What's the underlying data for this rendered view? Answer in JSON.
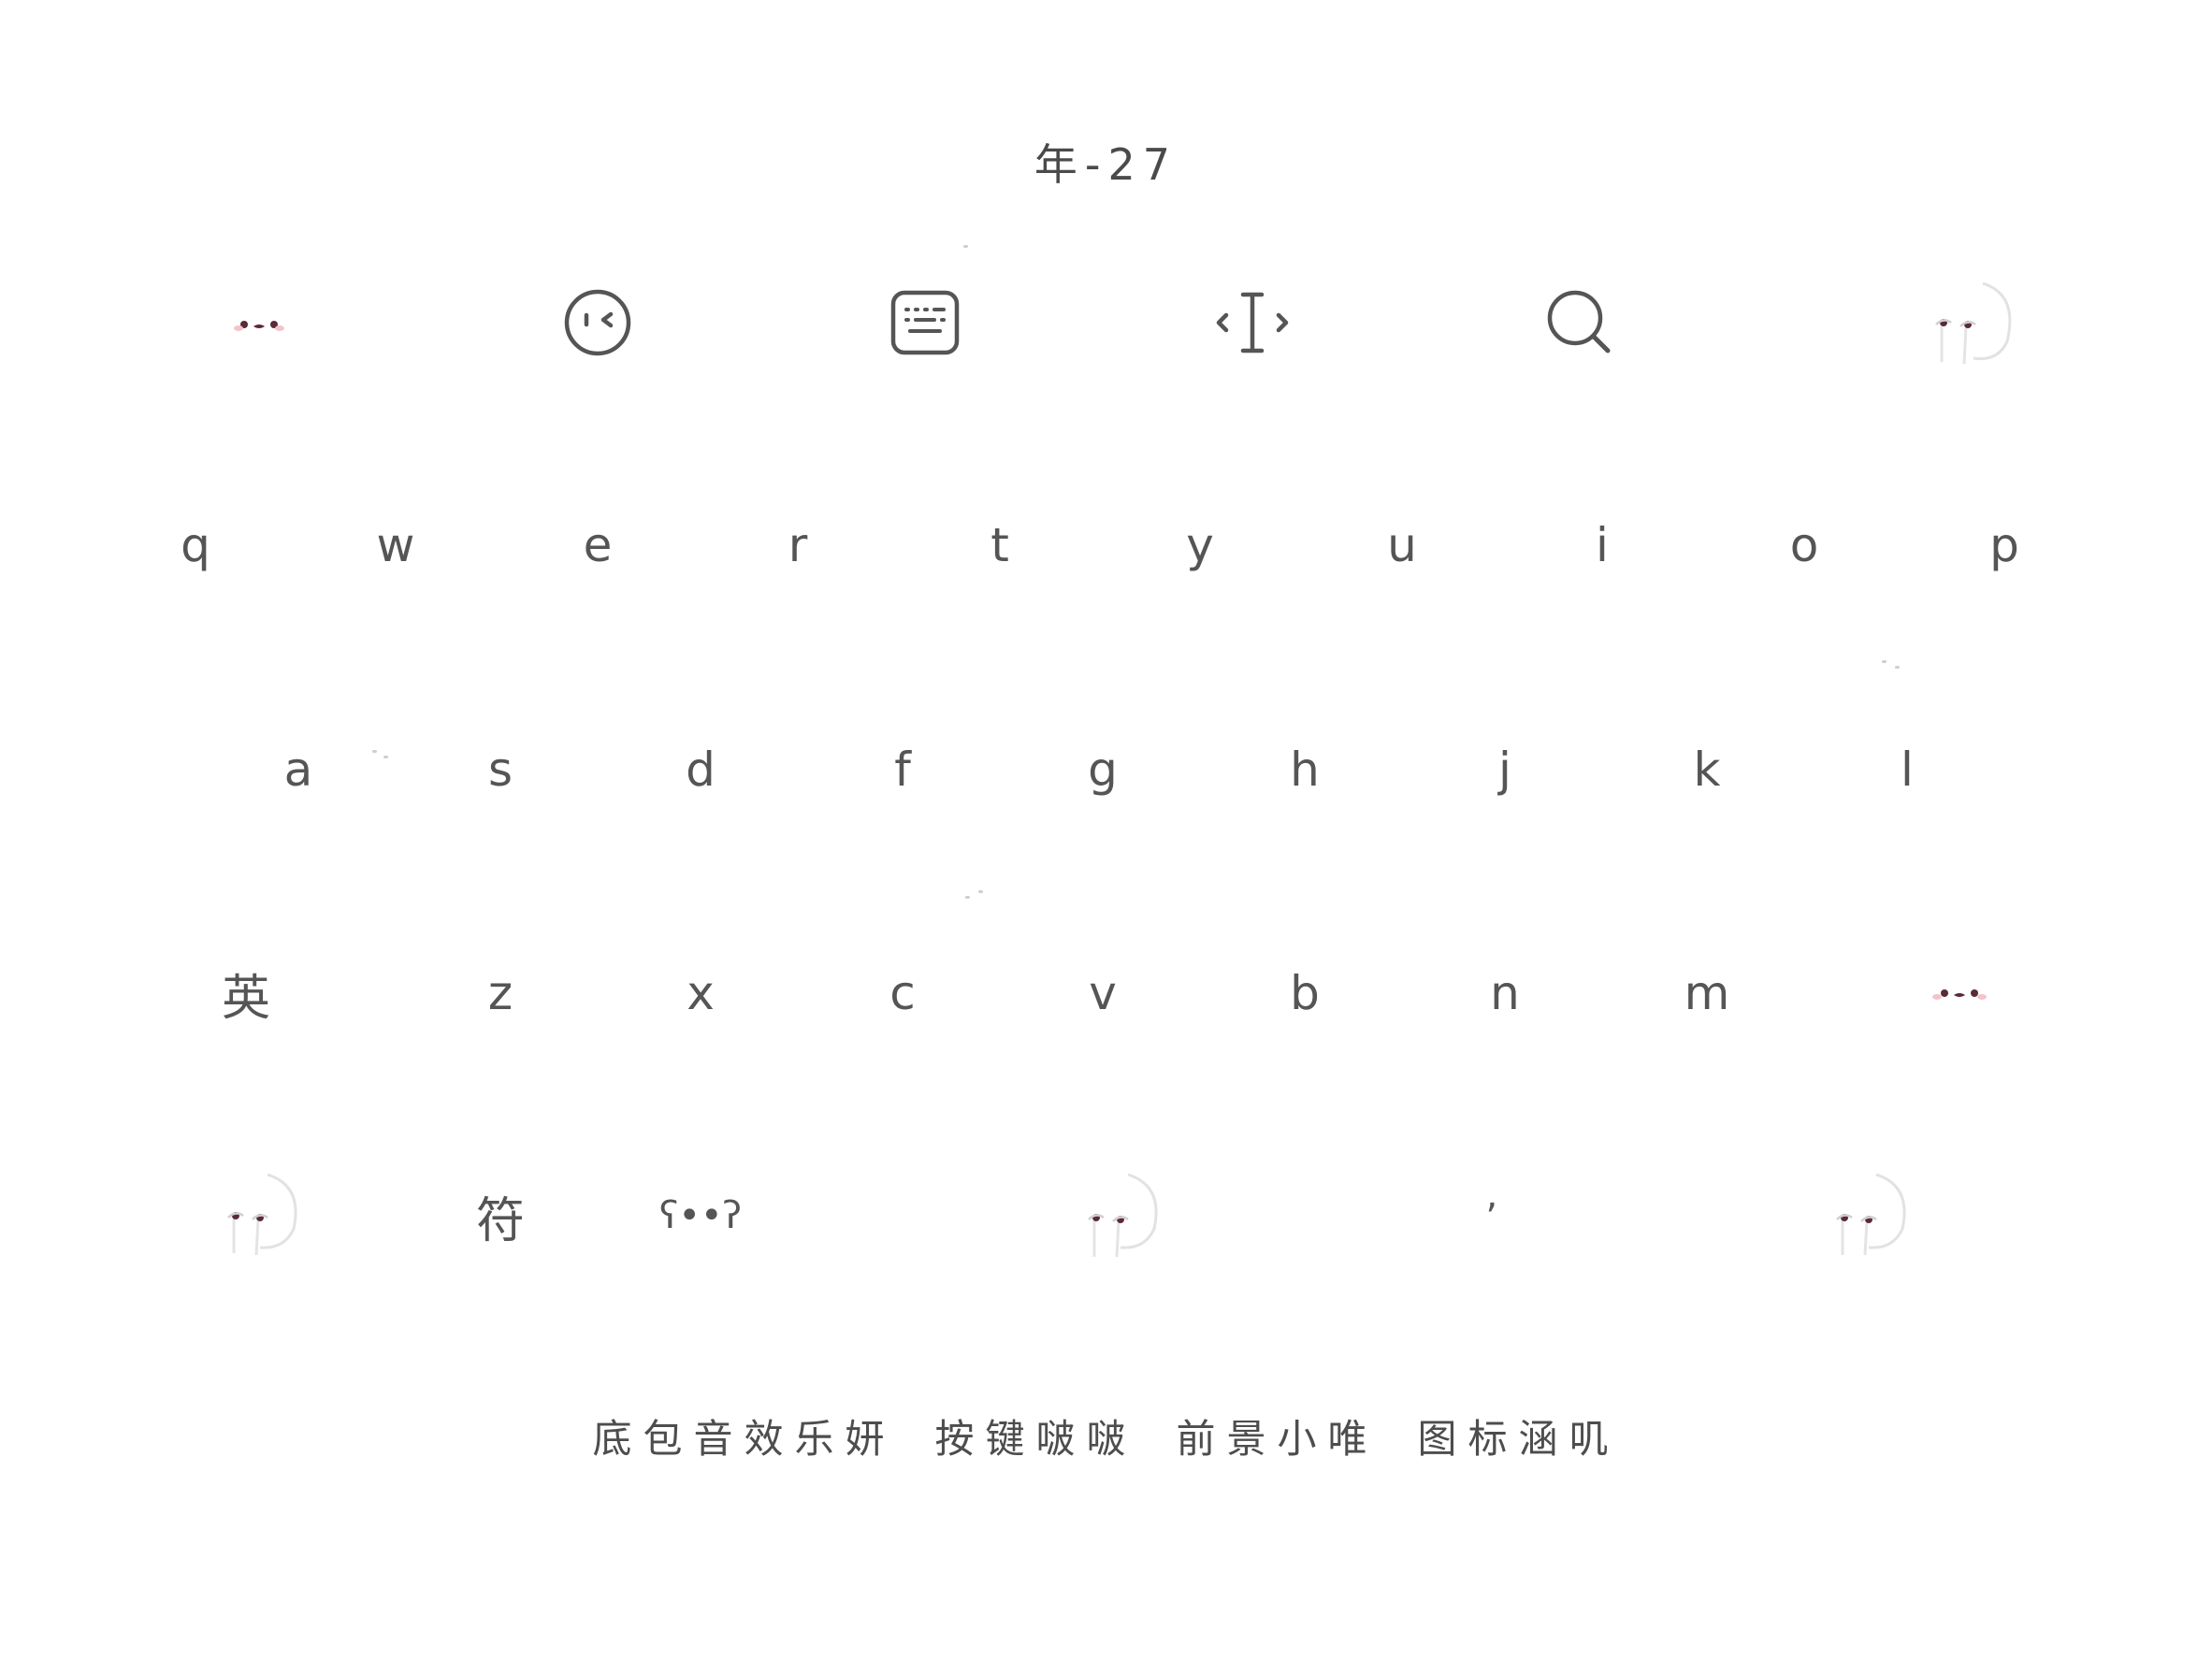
{
  "title": "年-27",
  "toolbar": {
    "items": [
      {
        "name": "creature-face-left-icon"
      },
      {
        "name": "emoji-wink-icon"
      },
      {
        "name": "keyboard-icon"
      },
      {
        "name": "text-cursor-icon"
      },
      {
        "name": "search-icon"
      },
      {
        "name": "creature-peek-right-icon"
      }
    ]
  },
  "keys": {
    "row1": [
      "q",
      "w",
      "e",
      "r",
      "t",
      "y",
      "u",
      "i",
      "o",
      "p"
    ],
    "row2": [
      "a",
      "s",
      "d",
      "f",
      "g",
      "h",
      "j",
      "k",
      "l"
    ],
    "row3": {
      "lang": "英",
      "letters": [
        "z",
        "x",
        "c",
        "v",
        "b",
        "n",
        "m"
      ]
    },
    "row4": {
      "symbol": "符",
      "emoticon": "ʕ••ʔ",
      "comma": ","
    }
  },
  "credits": [
    "底包音效乐妍",
    "按键啵啵",
    "前景小唯",
    "图标涵叽"
  ],
  "colors": {
    "background": "#ffffff",
    "key_text": "#555555",
    "creature_eye": "#5a2a35",
    "creature_blush": "#e8a0a8"
  }
}
